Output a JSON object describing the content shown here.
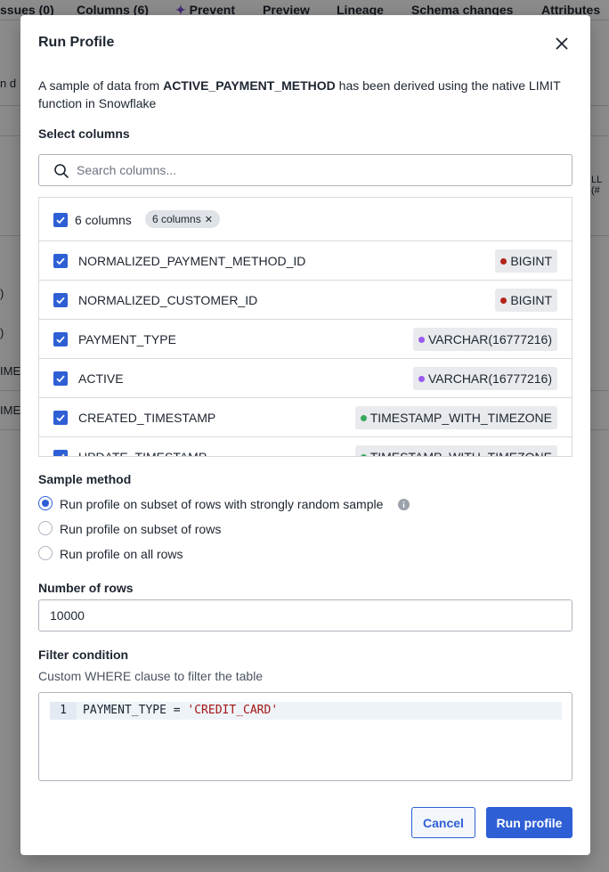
{
  "background": {
    "tabs": [
      "ssues (0)",
      "Columns (6)",
      "Prevent",
      "Preview",
      "Lineage",
      "Schema changes",
      "Attributes"
    ],
    "fragments": [
      "n d",
      "LL (#",
      ")",
      ")",
      "IME",
      "IME"
    ]
  },
  "modal": {
    "title": "Run Profile",
    "description": {
      "prefix": "A sample of data from ",
      "table": "ACTIVE_PAYMENT_METHOD",
      "suffix": " has been derived using the native LIMIT function in Snowflake"
    },
    "select_columns": {
      "label": "Select columns",
      "search_placeholder": "Search columns...",
      "all_label": "6 columns",
      "chip_label": "6 columns",
      "columns": [
        {
          "name": "NORMALIZED_PAYMENT_METHOD_ID",
          "type": "BIGINT",
          "color": "#b42318"
        },
        {
          "name": "NORMALIZED_CUSTOMER_ID",
          "type": "BIGINT",
          "color": "#b42318"
        },
        {
          "name": "PAYMENT_TYPE",
          "type": "VARCHAR(16777216)",
          "color": "#9b59f0"
        },
        {
          "name": "ACTIVE",
          "type": "VARCHAR(16777216)",
          "color": "#9b59f0"
        },
        {
          "name": "CREATED_TIMESTAMP",
          "type": "TIMESTAMP_WITH_TIMEZONE",
          "color": "#36a85a"
        },
        {
          "name": "UPDATE_TIMESTAMP",
          "type": "TIMESTAMP_WITH_TIMEZONE",
          "color": "#36a85a"
        }
      ]
    },
    "sample_method": {
      "label": "Sample method",
      "options": [
        "Run profile on subset of rows with strongly random sample",
        "Run profile on subset of rows",
        "Run profile on all rows"
      ],
      "selected": 0
    },
    "number_of_rows": {
      "label": "Number of rows",
      "value": "10000"
    },
    "filter": {
      "label": "Filter condition",
      "description": "Custom WHERE clause to filter the table",
      "line_number": "1",
      "code_prefix": "PAYMENT_TYPE = ",
      "code_string": "'CREDIT_CARD'"
    },
    "buttons": {
      "cancel": "Cancel",
      "run": "Run profile"
    }
  }
}
